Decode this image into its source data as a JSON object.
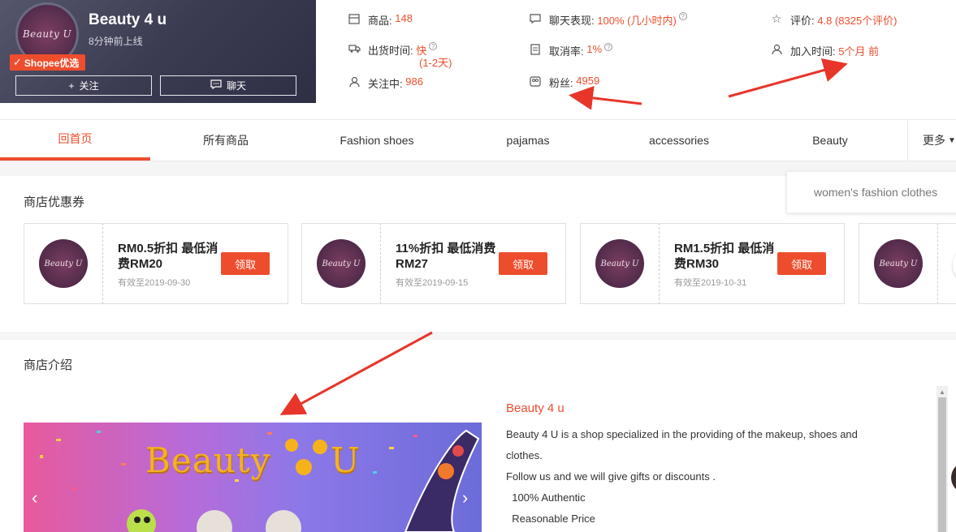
{
  "shop": {
    "name": "Beauty 4 u",
    "status": "8分钟前上线",
    "badge": "Shopee优选",
    "logo_text": "Beauty U",
    "follow_label": "关注",
    "chat_label": "聊天"
  },
  "stats": {
    "products_label": "商品:",
    "products_value": "148",
    "chat_label": "聊天表现:",
    "chat_value": "100% (几小时内)",
    "rating_label": "评价:",
    "rating_value": "4.8 (8325个评价)",
    "ship_label": "出货时间:",
    "ship_value": "快",
    "ship_sub": "(1-2天)",
    "cancel_label": "取消率:",
    "cancel_value": "1%",
    "joined_label": "加入时间:",
    "joined_value": "5个月 前",
    "following_label": "关注中:",
    "following_value": "986",
    "fans_label": "粉丝:",
    "fans_value": "4959"
  },
  "nav": {
    "tabs": [
      "回首页",
      "所有商品",
      "Fashion shoes",
      "pajamas",
      "accessories",
      "Beauty"
    ],
    "more": "更多",
    "dropdown_item": "women's fashion clothes"
  },
  "vouchers": {
    "title": "商店优惠券",
    "claim_label": "领取",
    "items": [
      {
        "title": "RM0.5折扣 最低消费RM20",
        "expiry": "有效至2019-09-30"
      },
      {
        "title": "11%折扣 最低消费RM27",
        "expiry": "有效至2019-09-15"
      },
      {
        "title": "RM1.5折扣 最低消费RM30",
        "expiry": "有效至2019-10-31"
      }
    ]
  },
  "about": {
    "title": "商店介绍",
    "name": "Beauty 4 u",
    "lines": [
      "Beauty 4 U is a shop specialized in the providing of the makeup, shoes and",
      "clothes.",
      "Follow us and we will give gifts or discounts .",
      "  100% Authentic",
      "  Reasonable Price"
    ],
    "banner_word": "Beauty",
    "banner_letter": "U"
  },
  "colors": {
    "accent": "#ee4d2d",
    "card_bg": "#3b3b52",
    "arrow": "#e8352a"
  }
}
